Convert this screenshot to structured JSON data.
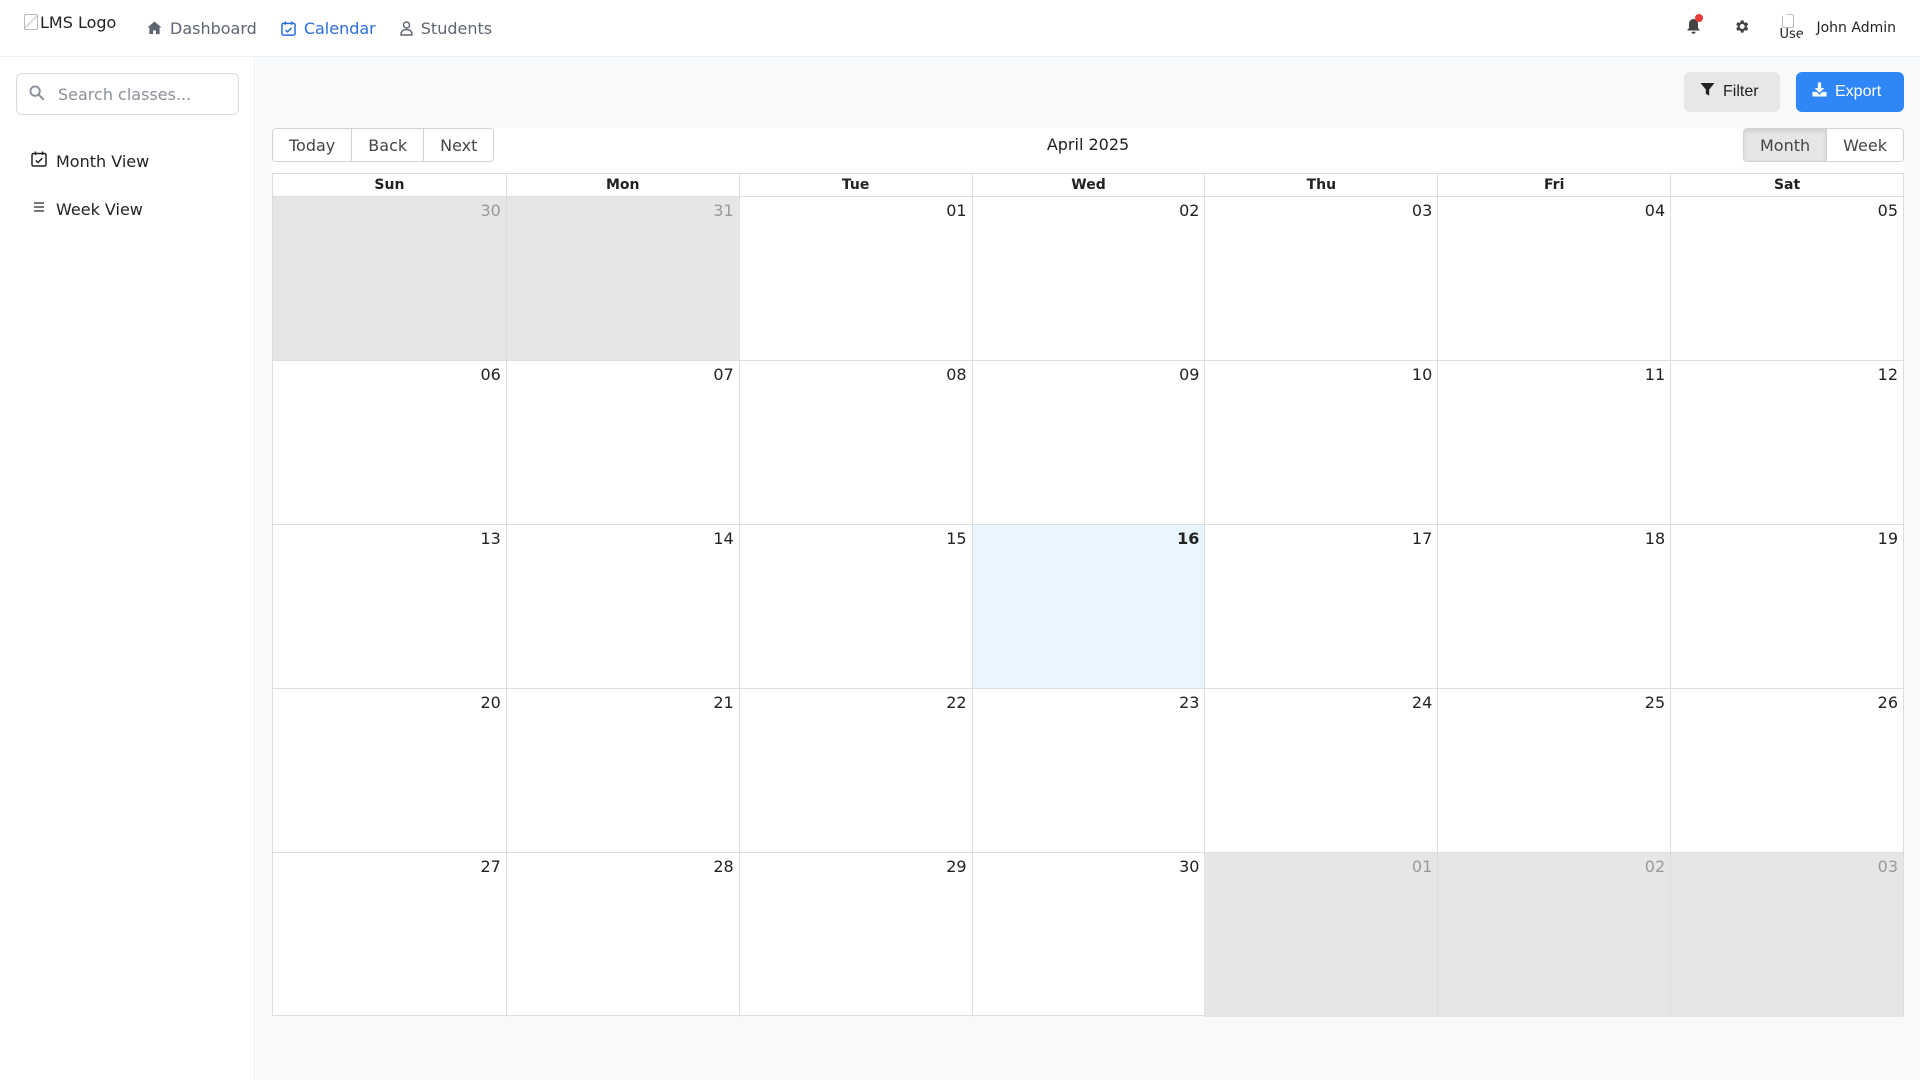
{
  "header": {
    "logo_alt": "LMS Logo",
    "nav": [
      {
        "label": "Dashboard",
        "icon": "home-icon"
      },
      {
        "label": "Calendar",
        "icon": "calendar-icon",
        "active": true
      },
      {
        "label": "Students",
        "icon": "user-icon"
      }
    ],
    "notification_badge_color": "#ea3b3b",
    "avatar_alt": "Use",
    "user_name": "John Admin"
  },
  "sidebar": {
    "search_placeholder": "Search classes...",
    "items": [
      {
        "label": "Month View",
        "icon": "calendar-check-icon"
      },
      {
        "label": "Week View",
        "icon": "list-icon"
      }
    ]
  },
  "actions": {
    "filter_label": "Filter",
    "export_label": "Export",
    "export_color": "#2f86f6"
  },
  "calendar": {
    "nav_buttons": [
      "Today",
      "Back",
      "Next"
    ],
    "title": "April 2025",
    "view_buttons": [
      "Month",
      "Week"
    ],
    "active_view": "Month",
    "weekdays": [
      "Sun",
      "Mon",
      "Tue",
      "Wed",
      "Thu",
      "Fri",
      "Sat"
    ],
    "today": "16",
    "today_color": "#eaf6ff",
    "weeks": [
      [
        {
          "d": "30",
          "off": true
        },
        {
          "d": "31",
          "off": true
        },
        {
          "d": "01"
        },
        {
          "d": "02"
        },
        {
          "d": "03"
        },
        {
          "d": "04"
        },
        {
          "d": "05"
        }
      ],
      [
        {
          "d": "06"
        },
        {
          "d": "07"
        },
        {
          "d": "08"
        },
        {
          "d": "09"
        },
        {
          "d": "10"
        },
        {
          "d": "11"
        },
        {
          "d": "12"
        }
      ],
      [
        {
          "d": "13"
        },
        {
          "d": "14"
        },
        {
          "d": "15"
        },
        {
          "d": "16",
          "today": true
        },
        {
          "d": "17"
        },
        {
          "d": "18"
        },
        {
          "d": "19"
        }
      ],
      [
        {
          "d": "20"
        },
        {
          "d": "21"
        },
        {
          "d": "22"
        },
        {
          "d": "23"
        },
        {
          "d": "24"
        },
        {
          "d": "25"
        },
        {
          "d": "26"
        }
      ],
      [
        {
          "d": "27"
        },
        {
          "d": "28"
        },
        {
          "d": "29"
        },
        {
          "d": "30"
        },
        {
          "d": "01",
          "off": true
        },
        {
          "d": "02",
          "off": true
        },
        {
          "d": "03",
          "off": true
        }
      ]
    ]
  }
}
